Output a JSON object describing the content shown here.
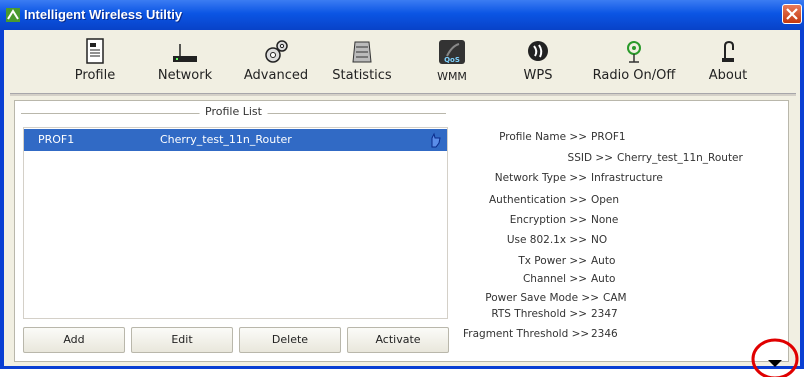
{
  "window": {
    "title": "Intelligent Wireless Utiltiy"
  },
  "toolbar": {
    "items": [
      {
        "label": "Profile",
        "icon": "profile-icon"
      },
      {
        "label": "Network",
        "icon": "network-icon"
      },
      {
        "label": "Advanced",
        "icon": "advanced-icon"
      },
      {
        "label": "Statistics",
        "icon": "statistics-icon"
      },
      {
        "label": "WMM",
        "icon": "wmm-icon"
      },
      {
        "label": "WPS",
        "icon": "wps-icon"
      },
      {
        "label": "Radio On/Off",
        "icon": "radio-icon"
      },
      {
        "label": "About",
        "icon": "about-icon"
      }
    ]
  },
  "profile_list": {
    "heading": "Profile List",
    "rows": [
      {
        "name": "PROF1",
        "ssid": "Cherry_test_11n_Router"
      }
    ]
  },
  "buttons": {
    "add": "Add",
    "edit": "Edit",
    "delete": "Delete",
    "activate": "Activate"
  },
  "details": [
    {
      "key": "Profile Name >>",
      "value": "PROF1"
    },
    {
      "key": "SSID >>",
      "value": "Cherry_test_11n_Router"
    },
    {
      "key": "Network Type >>",
      "value": "Infrastructure"
    },
    {
      "key": "Authentication >>",
      "value": "Open"
    },
    {
      "key": "Encryption >>",
      "value": "None"
    },
    {
      "key": "Use 802.1x >>",
      "value": "NO"
    },
    {
      "key": "Tx Power >>",
      "value": "Auto"
    },
    {
      "key": "Channel >>",
      "value": "Auto"
    },
    {
      "key": "Power Save Mode >>",
      "value": "CAM"
    },
    {
      "key": "RTS Threshold >>",
      "value": "2347"
    },
    {
      "key": "Fragment Threshold >>",
      "value": "2346"
    }
  ],
  "colors": {
    "selection": "#316ac5",
    "titlebar": "#0b55e4",
    "highlight_circle": "#e00000"
  }
}
